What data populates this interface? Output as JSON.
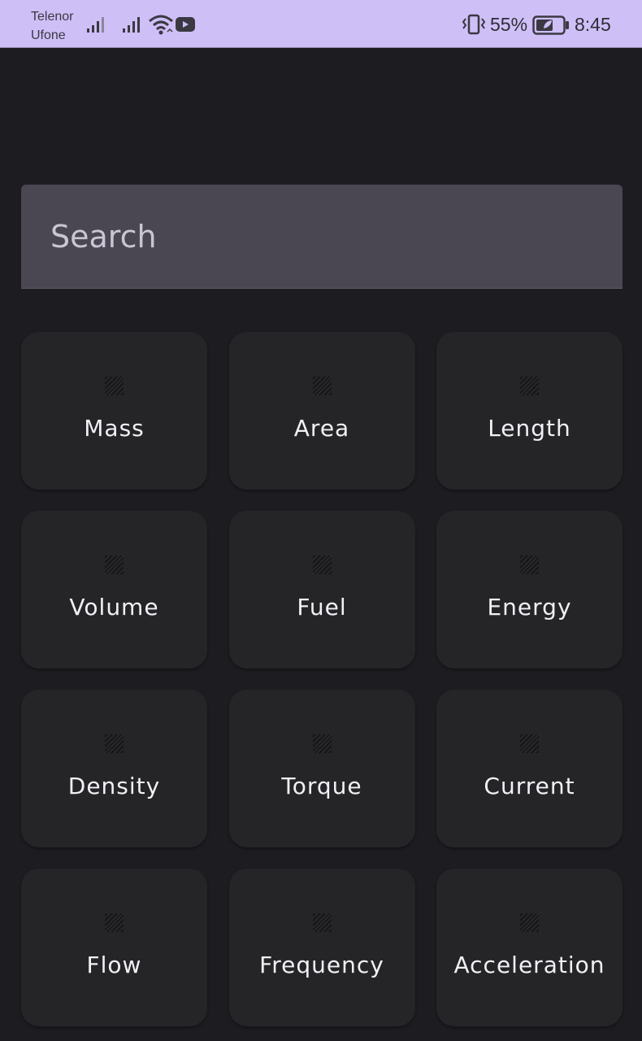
{
  "status_bar": {
    "carrier_1": "Telenor",
    "carrier_2": "Ufone",
    "battery_percent": "55%",
    "time": "8:45",
    "icons": [
      "signal-icon",
      "signal-icon",
      "wifi-icon",
      "youtube-icon",
      "vibrate-icon",
      "battery-icon"
    ]
  },
  "search": {
    "placeholder": "Search",
    "value": ""
  },
  "categories": [
    {
      "label": "Mass",
      "icon": "image-placeholder-icon"
    },
    {
      "label": "Area",
      "icon": "image-placeholder-icon"
    },
    {
      "label": "Length",
      "icon": "image-placeholder-icon"
    },
    {
      "label": "Volume",
      "icon": "image-placeholder-icon"
    },
    {
      "label": "Fuel",
      "icon": "image-placeholder-icon"
    },
    {
      "label": "Energy",
      "icon": "image-placeholder-icon"
    },
    {
      "label": "Density",
      "icon": "image-placeholder-icon"
    },
    {
      "label": "Torque",
      "icon": "image-placeholder-icon"
    },
    {
      "label": "Current",
      "icon": "image-placeholder-icon"
    },
    {
      "label": "Flow",
      "icon": "image-placeholder-icon"
    },
    {
      "label": "Frequency",
      "icon": "image-placeholder-icon"
    },
    {
      "label": "Acceleration",
      "icon": "image-placeholder-icon"
    }
  ],
  "colors": {
    "status_bar_bg": "#cfbff7",
    "app_bg": "#1d1c21",
    "search_bg": "#4a4652",
    "card_bg": "#252527",
    "label_text": "#f2eff6"
  }
}
